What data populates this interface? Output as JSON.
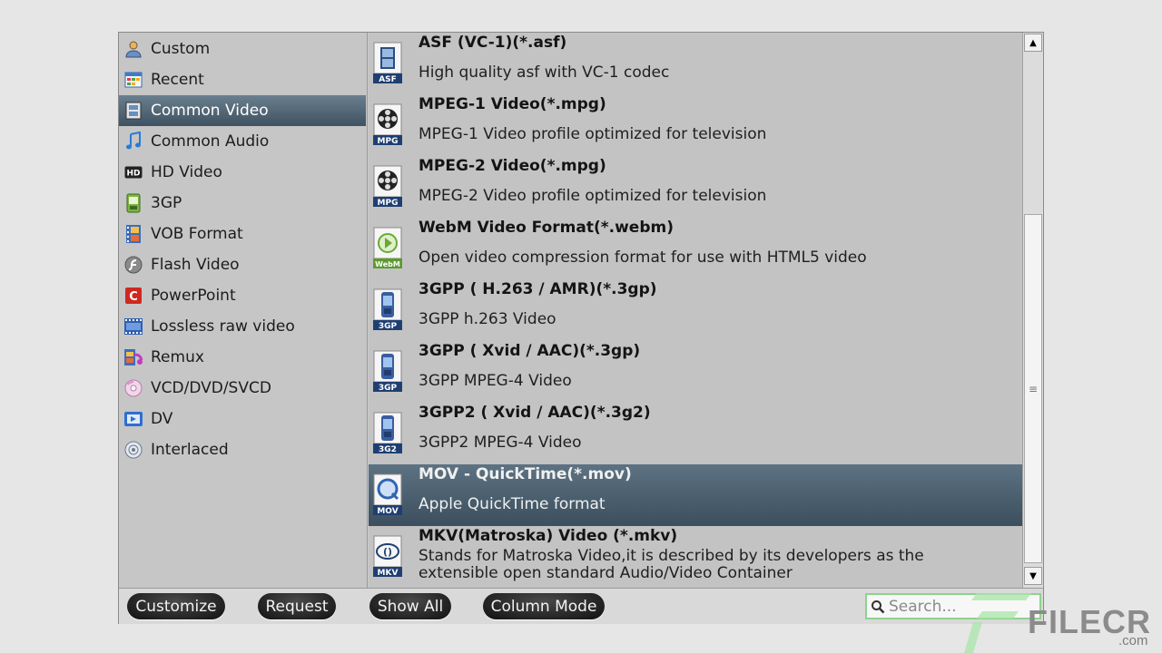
{
  "categories": [
    {
      "label": "Custom",
      "icon": "user-icon"
    },
    {
      "label": "Recent",
      "icon": "recent-icon"
    },
    {
      "label": "Common Video",
      "icon": "film-icon",
      "selected": true
    },
    {
      "label": "Common Audio",
      "icon": "music-note-icon"
    },
    {
      "label": "HD Video",
      "icon": "hd-icon"
    },
    {
      "label": "3GP",
      "icon": "phone-icon"
    },
    {
      "label": "VOB Format",
      "icon": "film-strip-icon"
    },
    {
      "label": "Flash Video",
      "icon": "flash-icon"
    },
    {
      "label": "PowerPoint",
      "icon": "powerpoint-icon"
    },
    {
      "label": "Lossless raw video",
      "icon": "raw-video-icon"
    },
    {
      "label": "Remux",
      "icon": "remux-icon"
    },
    {
      "label": "VCD/DVD/SVCD",
      "icon": "disc-icon"
    },
    {
      "label": "DV",
      "icon": "dv-icon"
    },
    {
      "label": "Interlaced",
      "icon": "interlaced-disc-icon"
    }
  ],
  "formats": [
    {
      "title": "ASF (VC-1)(*.asf)",
      "desc": "High quality asf with VC-1 codec",
      "badge": "ASF",
      "icon": "asf-file-icon"
    },
    {
      "title": "MPEG-1 Video(*.mpg)",
      "desc": "MPEG-1 Video profile optimized for television",
      "badge": "MPG",
      "icon": "mpg-file-icon"
    },
    {
      "title": "MPEG-2 Video(*.mpg)",
      "desc": "MPEG-2 Video profile optimized for television",
      "badge": "MPG",
      "icon": "mpg-file-icon"
    },
    {
      "title": "WebM Video Format(*.webm)",
      "desc": "Open video compression format for use with HTML5 video",
      "badge": "WebM",
      "icon": "webm-file-icon"
    },
    {
      "title": "3GPP ( H.263 / AMR)(*.3gp)",
      "desc": "3GPP h.263 Video",
      "badge": "3GP",
      "icon": "3gp-file-icon"
    },
    {
      "title": "3GPP ( Xvid / AAC)(*.3gp)",
      "desc": "3GPP MPEG-4 Video",
      "badge": "3GP",
      "icon": "3gp-file-icon"
    },
    {
      "title": "3GPP2 ( Xvid / AAC)(*.3g2)",
      "desc": "3GPP2 MPEG-4 Video",
      "badge": "3G2",
      "icon": "3g2-file-icon"
    },
    {
      "title": "MOV - QuickTime(*.mov)",
      "desc": "Apple QuickTime format",
      "badge": "MOV",
      "icon": "mov-file-icon",
      "selected": true
    },
    {
      "title": "MKV(Matroska) Video (*.mkv)",
      "desc": "Stands for Matroska Video,it is described by its developers as the extensible open standard Audio/Video Container",
      "badge": "MKV",
      "icon": "mkv-file-icon"
    }
  ],
  "buttons": {
    "customize": "Customize",
    "request": "Request",
    "show_all": "Show All",
    "column_mode": "Column Mode"
  },
  "search": {
    "placeholder": "Search..."
  },
  "watermark": {
    "brand": "FILECR",
    "suffix": ".com"
  },
  "colors": {
    "selected": "#4a5e6d",
    "search_border": "#8fd18f"
  }
}
